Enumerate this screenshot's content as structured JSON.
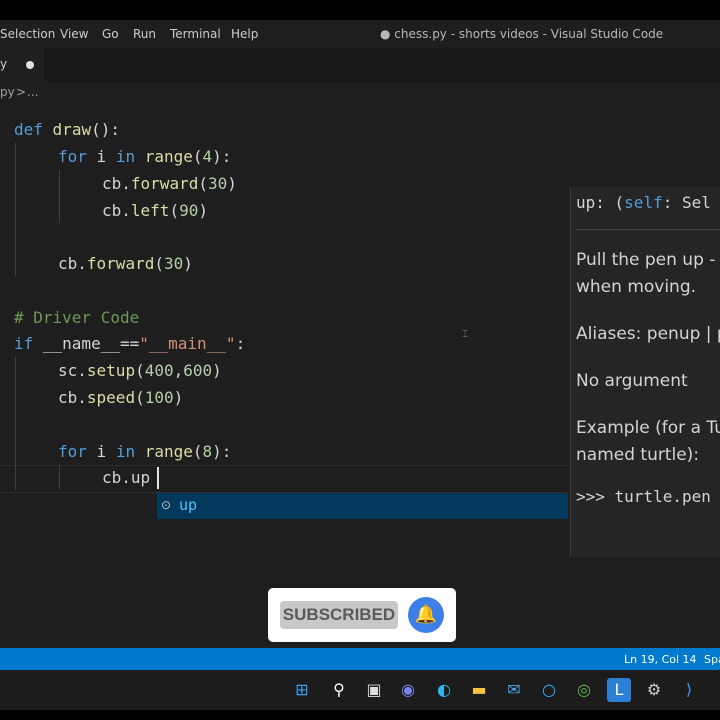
{
  "menu": {
    "items": [
      "Selection",
      "View",
      "Go",
      "Run",
      "Terminal",
      "Help"
    ],
    "window_title": "● chess.py - shorts videos - Visual Studio Code"
  },
  "tab": {
    "name": "y"
  },
  "breadcrumb": {
    "file": "py",
    "sep": ">",
    "rest": "..."
  },
  "code": {
    "l1_kw": "def",
    "l1_fn": "draw",
    "l1_rest": "():",
    "l2_kw1": "for",
    "l2_mid": " i ",
    "l2_kw2": "in",
    "l2_sp": " ",
    "l2_fn": "range",
    "l2_a": "(",
    "l2_num": "4",
    "l2_b": "):",
    "l3_pre": "cb.",
    "l3_fn": "forward",
    "l3_a": "(",
    "l3_num": "30",
    "l3_b": ")",
    "l4_pre": "cb.",
    "l4_fn": "left",
    "l4_a": "(",
    "l4_num": "90",
    "l4_b": ")",
    "l6_pre": "cb.",
    "l6_fn": "forward",
    "l6_a": "(",
    "l6_num": "30",
    "l6_b": ")",
    "l8_comment": "# Driver Code",
    "l9_kw": "if",
    "l9_mid": " __name__==",
    "l9_str": "\"__main__\"",
    "l9_end": ":",
    "l10_pre": "sc.",
    "l10_fn": "setup",
    "l10_a": "(",
    "l10_num1": "400",
    "l10_comma": ",",
    "l10_num2": "600",
    "l10_b": ")",
    "l11_pre": "cb.",
    "l11_fn": "speed",
    "l11_a": "(",
    "l11_num": "100",
    "l11_b": ")",
    "l13_kw1": "for",
    "l13_mid": " i ",
    "l13_kw2": "in",
    "l13_sp": " ",
    "l13_fn": "range",
    "l13_a": "(",
    "l13_num": "8",
    "l13_b": "):",
    "l14_text": "cb.up"
  },
  "suggestion": {
    "icon": "method-icon",
    "label": "up"
  },
  "hover": {
    "sig_pre": "up: (",
    "sig_self": "self",
    "sig_post": ": Sel",
    "p1a": "Pull the pen up -",
    "p1b": "when moving.",
    "p2": "Aliases: penup | p",
    "p3": "No argument",
    "p4a": "Example (for a Tu",
    "p4b": "named turtle):",
    "code": ">>> turtle.pen"
  },
  "overlay": {
    "subscribe_label": "SUBSCRIBED",
    "bell_icon": "bell-icon"
  },
  "status": {
    "position": "Ln 19, Col 14",
    "spaces": "Spa"
  },
  "taskbar": {
    "icons": [
      "windows-start-icon",
      "search-icon",
      "task-view-icon",
      "teams-icon",
      "edge-icon",
      "file-explorer-icon",
      "mail-icon",
      "cortana-icon",
      "chrome-icon",
      "l-app-icon",
      "settings-icon",
      "vscode-icon"
    ]
  }
}
